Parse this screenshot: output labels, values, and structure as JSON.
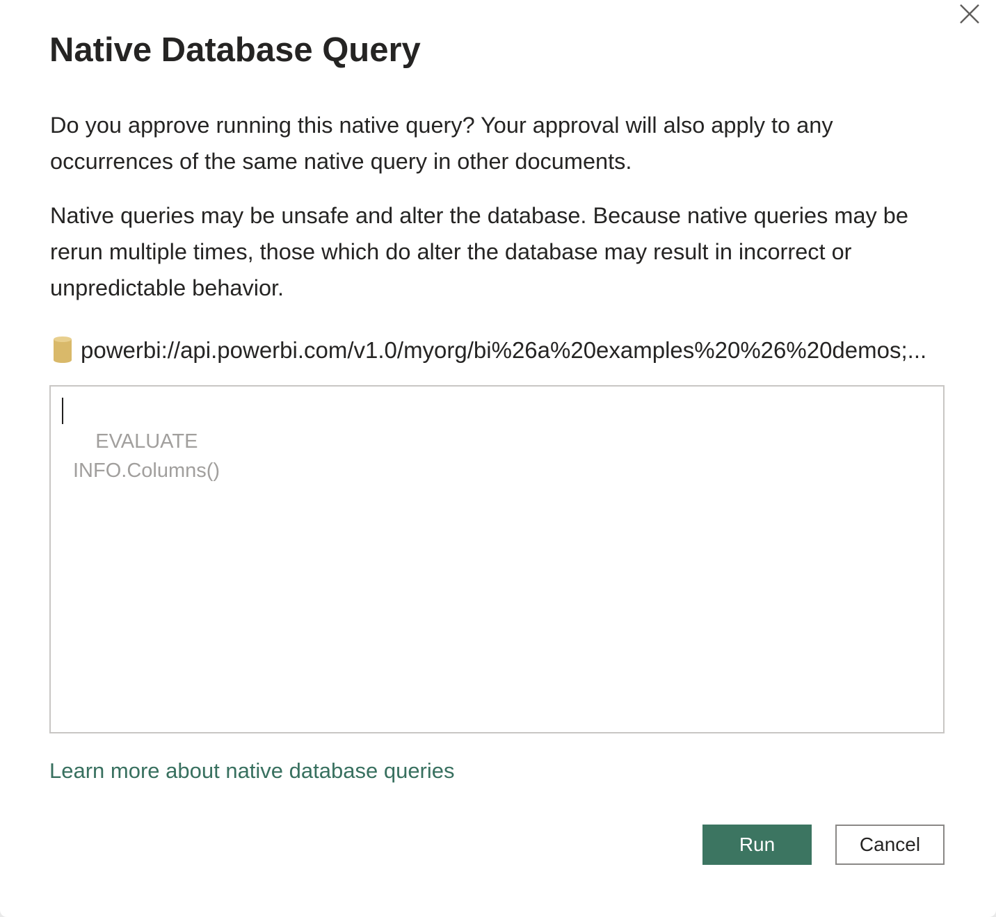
{
  "dialog": {
    "title": "Native Database Query",
    "close_label": "Close",
    "paragraphs": [
      "Do you approve running this native query? Your approval will also apply to any occurrences of the same native query in other documents.",
      "Native queries may be unsafe and alter the database. Because native queries may be rerun multiple times, those which do alter the database may result in incorrect or unpredictable behavior."
    ],
    "source": {
      "icon": "database-icon",
      "text": "powerbi://api.powerbi.com/v1.0/myorg/bi%26a%20examples%20%26%20demos;..."
    },
    "query": {
      "text": "    EVALUATE\nINFO.Columns()"
    },
    "learn_more_link": "Learn more about native database queries",
    "buttons": {
      "run": "Run",
      "cancel": "Cancel"
    }
  },
  "colors": {
    "accent": "#3c7561",
    "link": "#38705f",
    "text": "#252423",
    "query_text": "#a19f9d",
    "border": "#c8c6c4",
    "db_icon": "#d9b96a"
  }
}
